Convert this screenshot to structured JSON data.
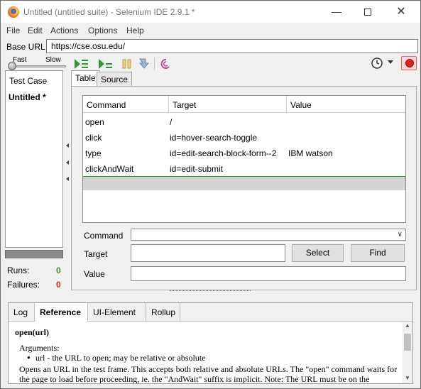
{
  "window": {
    "title": "Untitled (untitled suite) - Selenium IDE 2.9.1 *"
  },
  "menu": {
    "file": "File",
    "edit": "Edit",
    "actions": "Actions",
    "options": "Options",
    "help": "Help"
  },
  "base_url": {
    "label": "Base URL",
    "value": "https://cse.osu.edu/"
  },
  "toolbar": {
    "speed_fast": "Fast",
    "speed_slow": "Slow",
    "speed_level": 0.0,
    "record_color": "#e02020"
  },
  "suite": {
    "header": "Test Case",
    "test_case": "Untitled *",
    "runs_label": "Runs:",
    "runs_value": "0",
    "failures_label": "Failures:",
    "failures_value": "0"
  },
  "editor": {
    "tabs": [
      "Table",
      "Source"
    ],
    "columns": [
      "Command",
      "Target",
      "Value"
    ],
    "rows": [
      {
        "command": "open",
        "target": "/",
        "value": ""
      },
      {
        "command": "click",
        "target": "id=hover-search-toggle",
        "value": ""
      },
      {
        "command": "type",
        "target": "id=edit-search-block-form--2",
        "value": "IBM watson"
      },
      {
        "command": "clickAndWait",
        "target": "id=edit-submit",
        "value": ""
      }
    ],
    "command_label": "Command",
    "target_label": "Target",
    "value_label": "Value",
    "command_value": "",
    "target_value": "",
    "value_value": "",
    "select_button": "Select",
    "find_button": "Find"
  },
  "bottom": {
    "tabs": [
      "Log",
      "Reference",
      "UI-Element",
      "Rollup"
    ],
    "ref_title": "open(url)",
    "ref_args": "Arguments:",
    "ref_bullet": "url - the URL to open; may be relative or absolute",
    "ref_desc": "Opens an URL in the test frame. This accepts both relative and absolute URLs. The \"open\" command waits for the page to load before proceeding, ie. the \"AndWait\" suffix is implicit. Note: The URL must be on the"
  }
}
